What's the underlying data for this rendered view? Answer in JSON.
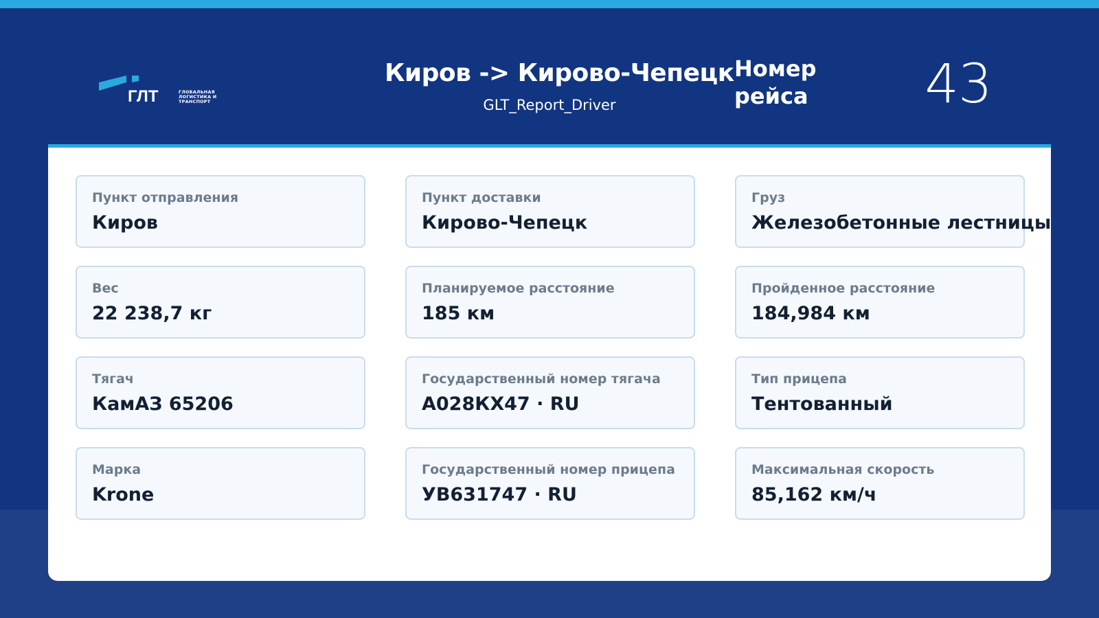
{
  "header": {
    "logo_text": "ГЛТ",
    "logo_tagline": "ГЛОБАЛЬНАЯ ЛОГИСТИКА И ТРАНСПОРТ",
    "route_title": "Киров -> Кирово-Чепецк",
    "report_name": "GLT_Report_Driver",
    "trip_label": "Номер рейса",
    "trip_number": "43"
  },
  "cards": [
    {
      "label": "Пункт отправления",
      "value": "Киров"
    },
    {
      "label": "Пункт доставки",
      "value": "Кирово-Чепецк"
    },
    {
      "label": "Груз",
      "value": "Железобетонные лестницы"
    },
    {
      "label": "Вес",
      "value": "22 238,7 кг"
    },
    {
      "label": "Планируемое расстояние",
      "value": "185 км"
    },
    {
      "label": "Пройденное расстояние",
      "value": "184,984 км"
    },
    {
      "label": "Тягач",
      "value": "КамАЗ 65206"
    },
    {
      "label": "Государственный номер тягача",
      "value": "А028КХ47 · RU"
    },
    {
      "label": "Тип прицепа",
      "value": "Тентованный"
    },
    {
      "label": "Марка",
      "value": "Krone"
    },
    {
      "label": "Государственный номер прицепа",
      "value": "УВ631747 · RU"
    },
    {
      "label": "Максимальная скорость",
      "value": "85,162 км/ч"
    }
  ],
  "colors": {
    "header_bg": "#123581",
    "accent": "#2aa9e0",
    "lower_bg": "#1f3f86",
    "card_bg": "#f5f9fd",
    "card_border": "#c8dcee",
    "label_text": "#6d7b8c",
    "value_text": "#132033"
  }
}
